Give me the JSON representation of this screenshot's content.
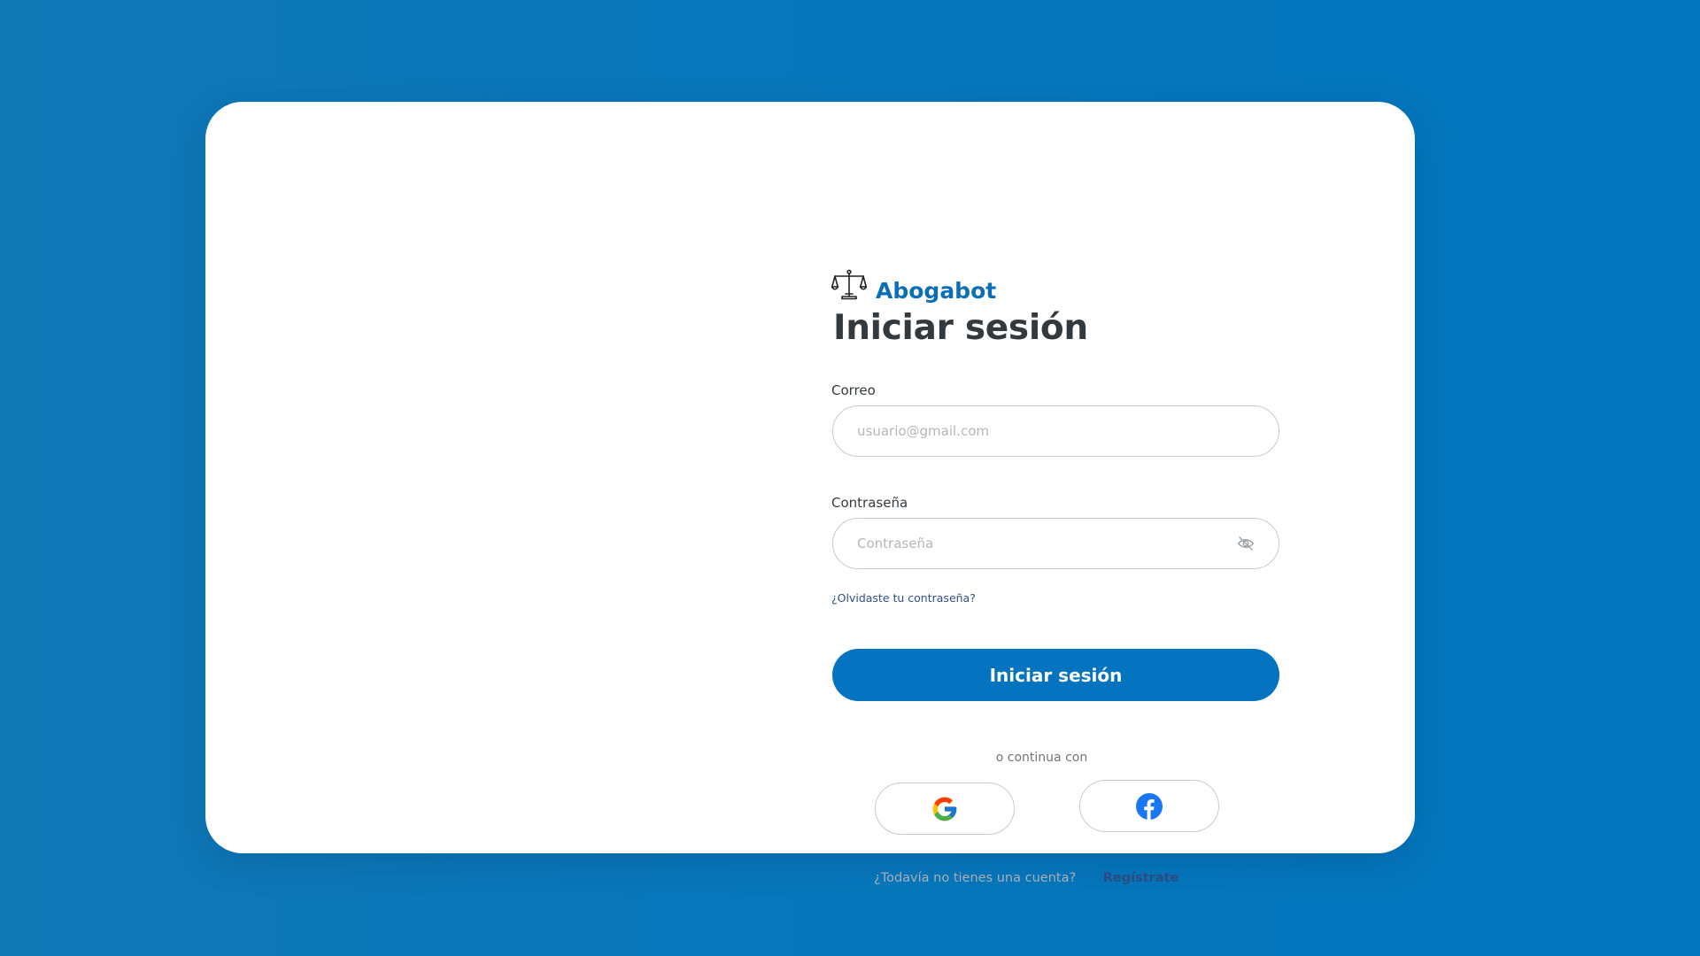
{
  "brand": {
    "name": "Abogabot",
    "icon": "scales-of-justice-icon",
    "color": "#0b6fb7"
  },
  "login": {
    "title": "Iniciar sesión",
    "email_label": "Correo",
    "email_placeholder": "usuario@gmail.com",
    "password_label": "Contraseña",
    "password_placeholder": "Contraseña",
    "password_toggle_icon": "eye-off-icon",
    "forgot_link": "¿Olvidaste tu contraseña?",
    "submit_label": "Iniciar sesión",
    "divider_text": "o continua con",
    "social": [
      {
        "provider": "google",
        "icon": "google-icon"
      },
      {
        "provider": "facebook",
        "icon": "facebook-icon"
      }
    ],
    "signup_question": "¿Todavía no tienes una cuenta?",
    "signup_link": "Regístrate"
  },
  "colors": {
    "background": "#0877bb",
    "card": "#ffffff",
    "primary_button": "#0574c0",
    "link": "#2d4f8a",
    "title": "#333a3f"
  }
}
